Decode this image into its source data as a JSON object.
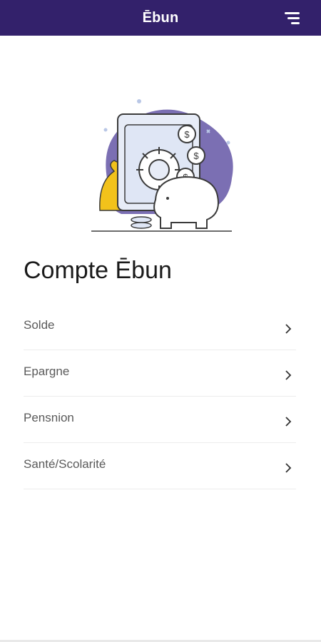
{
  "header": {
    "title": "Ēbun",
    "menu_icon": "hamburger-menu-icon",
    "background_color": "#33216b"
  },
  "hero": {
    "illustration": "safe-piggy-bank-coins-illustration",
    "accent_color": "#7b6fb3"
  },
  "page": {
    "title": "Compte Ēbun"
  },
  "menu": {
    "items": [
      {
        "label": "Solde",
        "icon": "chevron-right-icon"
      },
      {
        "label": "Epargne",
        "icon": "chevron-right-icon"
      },
      {
        "label": "Pensnion",
        "icon": "chevron-right-icon"
      },
      {
        "label": "Santé/Scolarité",
        "icon": "chevron-right-icon"
      }
    ]
  }
}
